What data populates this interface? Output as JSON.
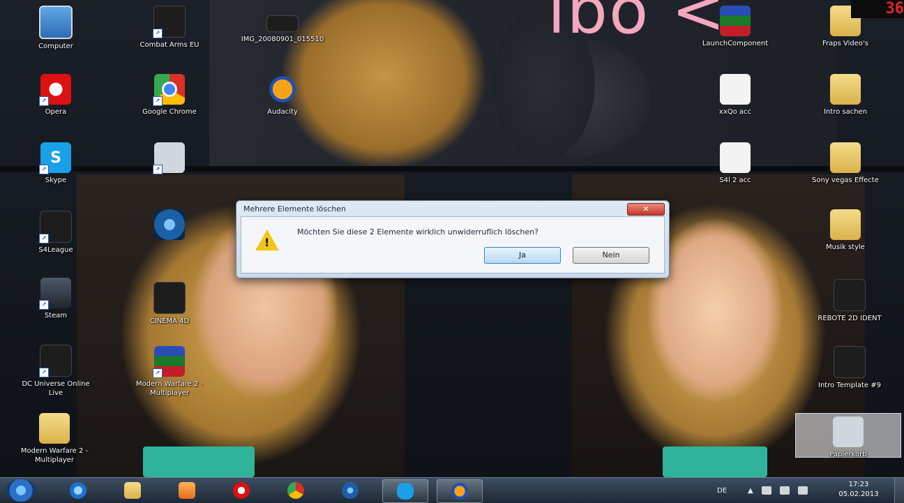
{
  "desktop": {
    "icons": [
      {
        "label": "Computer",
        "icon": "computer-icon"
      },
      {
        "label": "Combat Arms EU",
        "icon": "combat-arms-icon"
      },
      {
        "label": "IMG_20080901_015510",
        "icon": "image-file-icon"
      },
      {
        "label": "LaunchComponent",
        "icon": "launch-component-icon"
      },
      {
        "label": "Fraps Video's",
        "icon": "folder-icon"
      },
      {
        "label": "Opera",
        "icon": "opera-icon"
      },
      {
        "label": "Google Chrome",
        "icon": "chrome-icon"
      },
      {
        "label": "Audacity",
        "icon": "audacity-icon"
      },
      {
        "label": "xxQo acc",
        "icon": "text-file-icon"
      },
      {
        "label": "Intro sachen",
        "icon": "folder-icon"
      },
      {
        "label": "Skype",
        "icon": "skype-icon"
      },
      {
        "label": "S4l 2 acc",
        "icon": "text-file-icon"
      },
      {
        "label": "Sony vegas Effecte",
        "icon": "folder-icon"
      },
      {
        "label": "S4League",
        "icon": "s4league-icon"
      },
      {
        "label": "Musik style",
        "icon": "folder-icon"
      },
      {
        "label": "Steam",
        "icon": "steam-icon"
      },
      {
        "label": "CINEMA 4D",
        "icon": "video-file-icon"
      },
      {
        "label": "REBOTE 2D IDENT",
        "icon": "video-file-icon"
      },
      {
        "label": "DC Universe Online Live",
        "icon": "dc-universe-icon"
      },
      {
        "label": "Modern Warfare 2 - Multiplayer",
        "icon": "mw2-icon"
      },
      {
        "label": "Intro Template #9",
        "icon": "video-file-icon"
      },
      {
        "label": "Modern Warfare 2 - Multiplayer",
        "icon": "folder-icon"
      },
      {
        "label": "Papierkorb",
        "icon": "recycle-bin-icon"
      }
    ]
  },
  "dialog": {
    "title": "Mehrere Elemente löschen",
    "close_label": "✕",
    "message": "Möchten Sie diese 2 Elemente wirklich unwiderruflich löschen?",
    "yes_label": "Ja",
    "no_label": "Nein",
    "icon": "warning-icon"
  },
  "overlay": {
    "fps": "36",
    "wallpaper_text": "ibo <"
  },
  "taskbar": {
    "pinned": [
      "internet-explorer-icon",
      "explorer-folder-icon",
      "media-player-icon",
      "opera-icon",
      "chrome-icon",
      "blue-app-icon",
      "skype-icon",
      "audacity-icon"
    ],
    "language": "DE",
    "time": "17:23",
    "date": "05.02.2013"
  }
}
